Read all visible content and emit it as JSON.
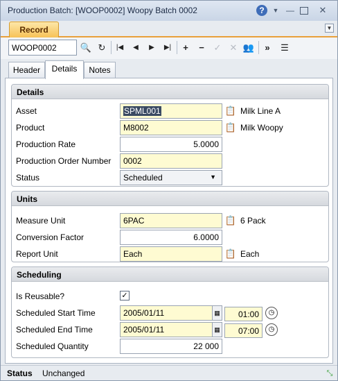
{
  "window": {
    "title": "Production Batch: [WOOP0002] Woopy Batch 0002"
  },
  "record_tab": "Record",
  "toolbar": {
    "search_value": "WOOP0002"
  },
  "tabs": [
    "Header",
    "Details",
    "Notes"
  ],
  "active_tab": "Details",
  "details": {
    "heading": "Details",
    "asset_label": "Asset",
    "asset_value": "SPML001",
    "asset_desc": "Milk Line A",
    "product_label": "Product",
    "product_value": "M8002",
    "product_desc": "Milk Woopy",
    "rate_label": "Production Rate",
    "rate_value": "5.0000",
    "order_label": "Production Order Number",
    "order_value": "0002",
    "status_label": "Status",
    "status_value": "Scheduled"
  },
  "units": {
    "heading": "Units",
    "measure_label": "Measure Unit",
    "measure_value": "6PAC",
    "measure_desc": "6 Pack",
    "conversion_label": "Conversion Factor",
    "conversion_value": "6.0000",
    "report_label": "Report Unit",
    "report_value": "Each",
    "report_desc": "Each"
  },
  "scheduling": {
    "heading": "Scheduling",
    "reusable_label": "Is Reusable?",
    "reusable_checked": true,
    "start_label": "Scheduled Start Time",
    "start_date": "2005/01/11",
    "start_time": "01:00",
    "end_label": "Scheduled End Time",
    "end_date": "2005/01/11",
    "end_time": "07:00",
    "qty_label": "Scheduled Quantity",
    "qty_value": "22 000"
  },
  "status": {
    "label": "Status",
    "value": "Unchanged"
  }
}
